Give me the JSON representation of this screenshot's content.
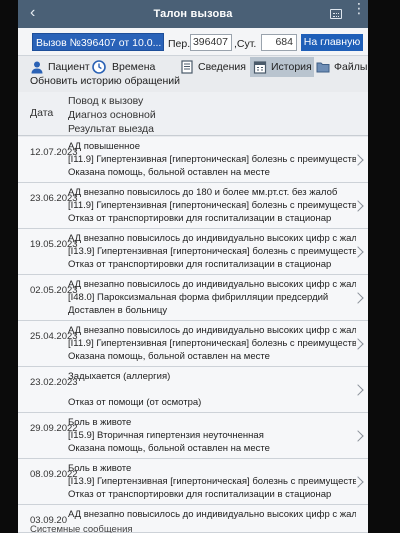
{
  "titlebar": {
    "title": "Талон вызова",
    "back_glyph": "‹",
    "kebab_glyph": "⋮"
  },
  "infobar": {
    "call_select": "Вызов №396407 от 10.0...",
    "per_label": "Пер.",
    "per_value": "396407",
    "sut_label": ",Сут.",
    "sut_value": "684",
    "home_button": "На главную"
  },
  "tabs": [
    {
      "label": "Пациент",
      "icon": "person-icon"
    },
    {
      "label": "Времена",
      "icon": "clock-icon"
    },
    {
      "label": "Сведения",
      "icon": "document-icon"
    },
    {
      "label": "История",
      "icon": "calendar-icon",
      "active": true
    },
    {
      "label": "Файлы",
      "icon": "folder-icon"
    }
  ],
  "refresh_link": "Обновить историю обращений",
  "columns": {
    "date": "Дата",
    "reason": "Повод к вызову",
    "diagnosis": "Диагноз основной",
    "result": "Результат выезда"
  },
  "history": [
    {
      "date": "12.07.2023",
      "reason": "АД повышенное",
      "diagnosis": "[I11.9] Гипертензивная [гипертоническая] болезнь с преимущественным",
      "result": "Оказана помощь, больной оставлен на месте"
    },
    {
      "date": "23.06.2023",
      "reason": "АД внезапно повысилось до 180 и более мм.рт.ст. без жалоб",
      "diagnosis": "[I11.9] Гипертензивная [гипертоническая] болезнь с преимущественным",
      "result": "Отказ от транспортировки для госпитализации в стационар"
    },
    {
      "date": "19.05.2023",
      "reason": "АД внезапно повысилось до индивидуально высоких цифр с жалобами",
      "diagnosis": "[I13.9] Гипертензивная [гипертоническая] болезнь с преимущественным",
      "result": "Отказ от транспортировки для госпитализации в стационар"
    },
    {
      "date": "02.05.2023",
      "reason": "АД внезапно повысилось до индивидуально высоких цифр с жалобами",
      "diagnosis": "[I48.0] Пароксизмальная форма фибрилляции предсердий",
      "result": "Доставлен в больницу"
    },
    {
      "date": "25.04.2023",
      "reason": "АД внезапно повысилось до индивидуально высоких цифр с жалобами",
      "diagnosis": "[I11.9] Гипертензивная [гипертоническая] болезнь с преимущественным",
      "result": "Оказана помощь, больной оставлен на месте"
    },
    {
      "date": "23.02.2023",
      "reason": "Задыхается (аллергия)",
      "diagnosis": "",
      "result": "Отказ от помощи (от осмотра)"
    },
    {
      "date": "29.09.2022",
      "reason": "Боль в животе",
      "diagnosis": "[I15.9] Вторичная гипертензия неуточненная",
      "result": "Оказана помощь, больной оставлен на месте"
    },
    {
      "date": "08.09.2022",
      "reason": "Боль в животе",
      "diagnosis": "[I13.9] Гипертензивная [гипертоническая] болезнь с преимущественным",
      "result": "Отказ от транспортировки для госпитализации в стационар"
    },
    {
      "date": "03.09.20",
      "reason": "АД внезапно повысилось до индивидуально высоких цифр с жалобами",
      "diagnosis": "",
      "result": ""
    }
  ],
  "system_messages": "Системные сообщения"
}
